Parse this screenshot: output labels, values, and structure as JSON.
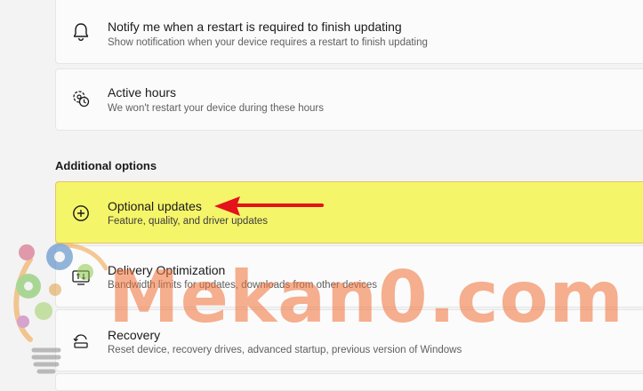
{
  "settings": {
    "notify": {
      "title": "Notify me when a restart is required to finish updating",
      "subtitle": "Show notification when your device requires a restart to finish updating",
      "icon": "bell-icon"
    },
    "active_hours": {
      "title": "Active hours",
      "subtitle": "We won't restart your device during these hours",
      "icon": "clock-settings-icon"
    }
  },
  "additional_options": {
    "heading": "Additional options",
    "items": [
      {
        "title": "Optional updates",
        "subtitle": "Feature, quality, and driver updates",
        "icon": "plus-circle-icon",
        "highlight": "#f5f56a"
      },
      {
        "title": "Delivery Optimization",
        "subtitle": "Bandwidth limits for updates, downloads from other devices",
        "icon": "delivery-optimization-icon"
      },
      {
        "title": "Recovery",
        "subtitle": "Reset device, recovery drives, advanced startup, previous version of Windows",
        "icon": "recovery-icon"
      }
    ]
  },
  "annotation": {
    "arrow_color": "#e3121b"
  },
  "watermark": {
    "text": "Mekan0.com",
    "color": "#f07034"
  }
}
